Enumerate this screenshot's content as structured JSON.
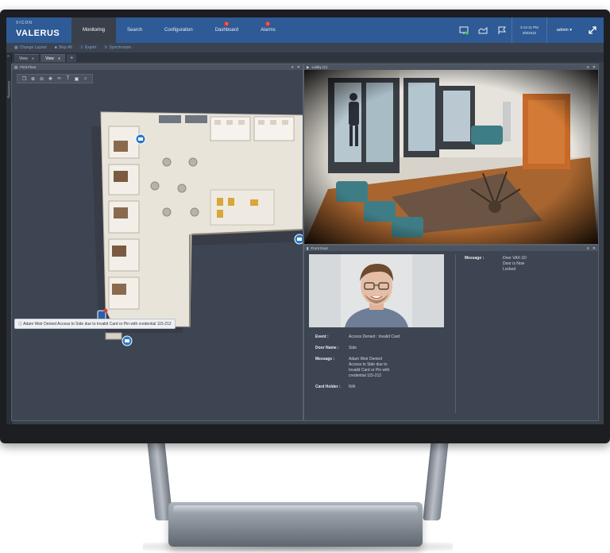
{
  "brand": {
    "small": "VICON",
    "name": "VALERUS"
  },
  "nav": [
    {
      "label": "Monitoring",
      "active": true,
      "badge": ""
    },
    {
      "label": "Search",
      "active": false,
      "badge": ""
    },
    {
      "label": "Configuration",
      "active": false,
      "badge": ""
    },
    {
      "label": "Dashboard",
      "active": false,
      "badge": "1"
    },
    {
      "label": "Alarms",
      "active": false,
      "badge": "1"
    }
  ],
  "clock": {
    "time": "3:14:11 PM",
    "date": "3/9/2022"
  },
  "user": {
    "name": "admin ▾"
  },
  "toolbar": {
    "change_layout": "Change Layout",
    "stop_all": "Stop All",
    "export": "Export",
    "synchronize": "Synchronize"
  },
  "tabs": [
    {
      "label": "View",
      "active": false
    },
    {
      "label": "View",
      "active": true
    }
  ],
  "tab_add": "+",
  "rail": {
    "label": "Resources",
    "arrow": "»"
  },
  "panels": {
    "floor": {
      "title": "First Floor"
    },
    "camera": {
      "title": "Lobby (C)"
    },
    "event": {
      "title": "Front Door"
    }
  },
  "alarm_tooltip": "Adam Weir Denied Access to Side due to Invalid Card or Pin with credential 115-212",
  "event": {
    "fields": [
      {
        "label": "Event :",
        "value": "Access Denied : Invalid Card"
      },
      {
        "label": "Door Name :",
        "value": "Side"
      },
      {
        "label": "Message :",
        "value": "Adam Weir Denied Access to Side due to Invalid Card or Pin with credential 115-212"
      },
      {
        "label": "Card Holder :",
        "value": "N/A"
      }
    ],
    "right_message": {
      "label": "Message :",
      "value": "Door VAX-1D Door is Now Locked"
    }
  },
  "icons": {
    "monitor_status": "monitor-check-icon",
    "ptz": "camera-icon",
    "flag": "flag-icon",
    "expand": "expand-icon"
  }
}
